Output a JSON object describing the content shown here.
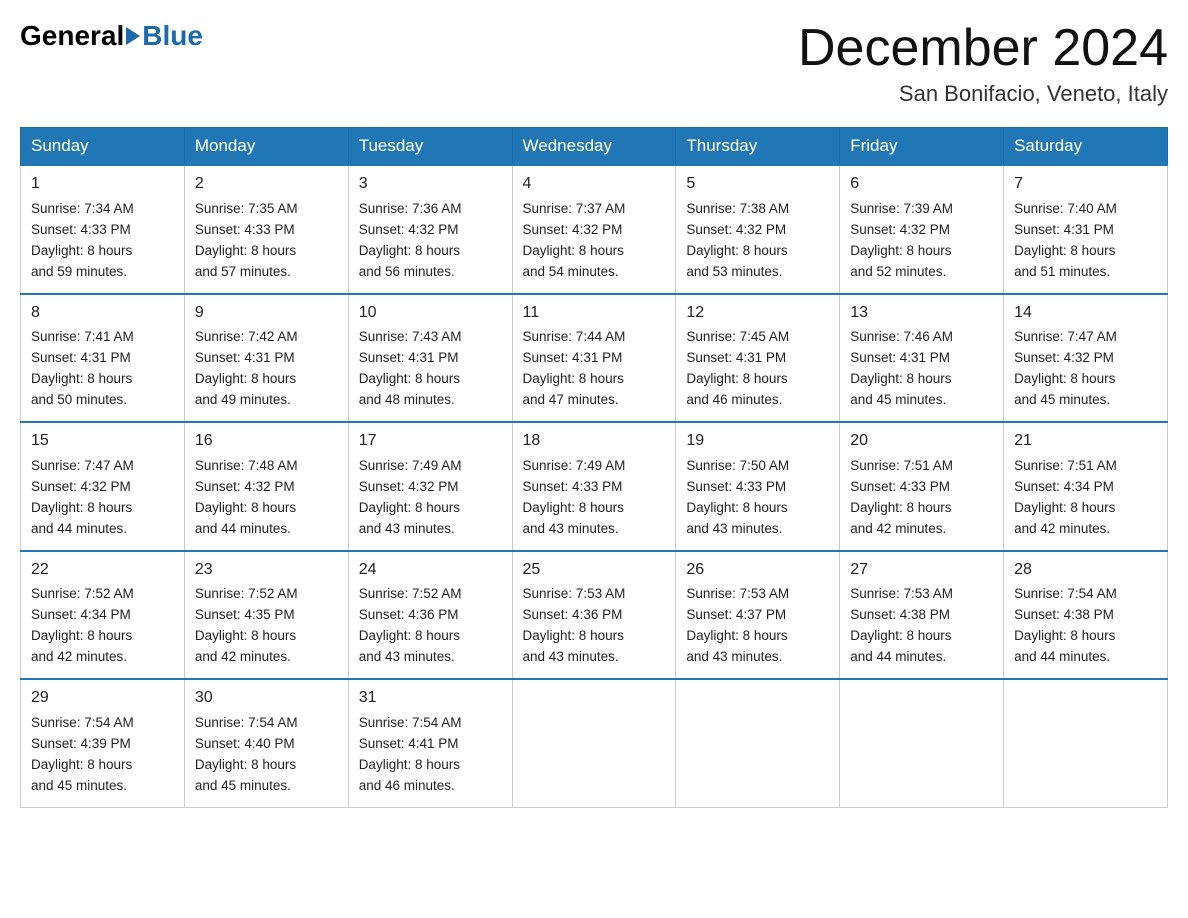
{
  "header": {
    "logo_general": "General",
    "logo_blue": "Blue",
    "month": "December 2024",
    "location": "San Bonifacio, Veneto, Italy"
  },
  "days_of_week": [
    "Sunday",
    "Monday",
    "Tuesday",
    "Wednesday",
    "Thursday",
    "Friday",
    "Saturday"
  ],
  "weeks": [
    [
      {
        "day": "1",
        "sunrise": "7:34 AM",
        "sunset": "4:33 PM",
        "daylight": "8 hours and 59 minutes."
      },
      {
        "day": "2",
        "sunrise": "7:35 AM",
        "sunset": "4:33 PM",
        "daylight": "8 hours and 57 minutes."
      },
      {
        "day": "3",
        "sunrise": "7:36 AM",
        "sunset": "4:32 PM",
        "daylight": "8 hours and 56 minutes."
      },
      {
        "day": "4",
        "sunrise": "7:37 AM",
        "sunset": "4:32 PM",
        "daylight": "8 hours and 54 minutes."
      },
      {
        "day": "5",
        "sunrise": "7:38 AM",
        "sunset": "4:32 PM",
        "daylight": "8 hours and 53 minutes."
      },
      {
        "day": "6",
        "sunrise": "7:39 AM",
        "sunset": "4:32 PM",
        "daylight": "8 hours and 52 minutes."
      },
      {
        "day": "7",
        "sunrise": "7:40 AM",
        "sunset": "4:31 PM",
        "daylight": "8 hours and 51 minutes."
      }
    ],
    [
      {
        "day": "8",
        "sunrise": "7:41 AM",
        "sunset": "4:31 PM",
        "daylight": "8 hours and 50 minutes."
      },
      {
        "day": "9",
        "sunrise": "7:42 AM",
        "sunset": "4:31 PM",
        "daylight": "8 hours and 49 minutes."
      },
      {
        "day": "10",
        "sunrise": "7:43 AM",
        "sunset": "4:31 PM",
        "daylight": "8 hours and 48 minutes."
      },
      {
        "day": "11",
        "sunrise": "7:44 AM",
        "sunset": "4:31 PM",
        "daylight": "8 hours and 47 minutes."
      },
      {
        "day": "12",
        "sunrise": "7:45 AM",
        "sunset": "4:31 PM",
        "daylight": "8 hours and 46 minutes."
      },
      {
        "day": "13",
        "sunrise": "7:46 AM",
        "sunset": "4:31 PM",
        "daylight": "8 hours and 45 minutes."
      },
      {
        "day": "14",
        "sunrise": "7:47 AM",
        "sunset": "4:32 PM",
        "daylight": "8 hours and 45 minutes."
      }
    ],
    [
      {
        "day": "15",
        "sunrise": "7:47 AM",
        "sunset": "4:32 PM",
        "daylight": "8 hours and 44 minutes."
      },
      {
        "day": "16",
        "sunrise": "7:48 AM",
        "sunset": "4:32 PM",
        "daylight": "8 hours and 44 minutes."
      },
      {
        "day": "17",
        "sunrise": "7:49 AM",
        "sunset": "4:32 PM",
        "daylight": "8 hours and 43 minutes."
      },
      {
        "day": "18",
        "sunrise": "7:49 AM",
        "sunset": "4:33 PM",
        "daylight": "8 hours and 43 minutes."
      },
      {
        "day": "19",
        "sunrise": "7:50 AM",
        "sunset": "4:33 PM",
        "daylight": "8 hours and 43 minutes."
      },
      {
        "day": "20",
        "sunrise": "7:51 AM",
        "sunset": "4:33 PM",
        "daylight": "8 hours and 42 minutes."
      },
      {
        "day": "21",
        "sunrise": "7:51 AM",
        "sunset": "4:34 PM",
        "daylight": "8 hours and 42 minutes."
      }
    ],
    [
      {
        "day": "22",
        "sunrise": "7:52 AM",
        "sunset": "4:34 PM",
        "daylight": "8 hours and 42 minutes."
      },
      {
        "day": "23",
        "sunrise": "7:52 AM",
        "sunset": "4:35 PM",
        "daylight": "8 hours and 42 minutes."
      },
      {
        "day": "24",
        "sunrise": "7:52 AM",
        "sunset": "4:36 PM",
        "daylight": "8 hours and 43 minutes."
      },
      {
        "day": "25",
        "sunrise": "7:53 AM",
        "sunset": "4:36 PM",
        "daylight": "8 hours and 43 minutes."
      },
      {
        "day": "26",
        "sunrise": "7:53 AM",
        "sunset": "4:37 PM",
        "daylight": "8 hours and 43 minutes."
      },
      {
        "day": "27",
        "sunrise": "7:53 AM",
        "sunset": "4:38 PM",
        "daylight": "8 hours and 44 minutes."
      },
      {
        "day": "28",
        "sunrise": "7:54 AM",
        "sunset": "4:38 PM",
        "daylight": "8 hours and 44 minutes."
      }
    ],
    [
      {
        "day": "29",
        "sunrise": "7:54 AM",
        "sunset": "4:39 PM",
        "daylight": "8 hours and 45 minutes."
      },
      {
        "day": "30",
        "sunrise": "7:54 AM",
        "sunset": "4:40 PM",
        "daylight": "8 hours and 45 minutes."
      },
      {
        "day": "31",
        "sunrise": "7:54 AM",
        "sunset": "4:41 PM",
        "daylight": "8 hours and 46 minutes."
      },
      null,
      null,
      null,
      null
    ]
  ],
  "labels": {
    "sunrise": "Sunrise:",
    "sunset": "Sunset:",
    "daylight": "Daylight:"
  }
}
